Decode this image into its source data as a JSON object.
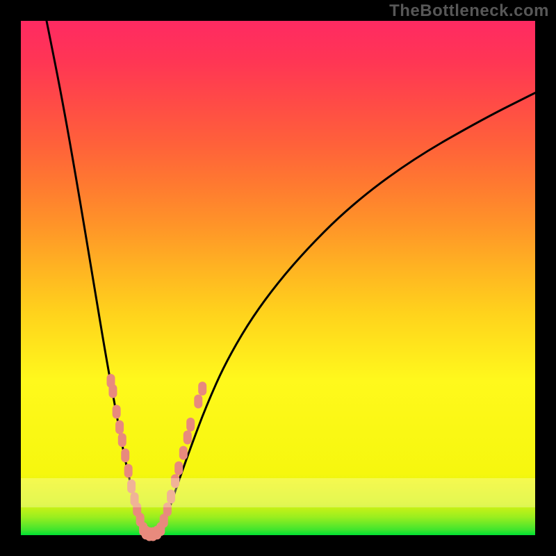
{
  "watermark": "TheBottleneck.com",
  "chart_data": {
    "type": "line",
    "title": "",
    "xlabel": "",
    "ylabel": "",
    "xlim": [
      0,
      100
    ],
    "ylim": [
      0,
      100
    ],
    "curves": [
      {
        "name": "left-falling",
        "x": [
          5,
          8,
          11,
          14,
          16.5,
          18.5,
          20,
          21.3,
          22.4,
          23.2,
          24
        ],
        "y": [
          100,
          85,
          68,
          50,
          35,
          24,
          16,
          10,
          6,
          2.5,
          0
        ]
      },
      {
        "name": "right-rising",
        "x": [
          27,
          28.5,
          30.5,
          33,
          36,
          40,
          46,
          54,
          64,
          76,
          90,
          100
        ],
        "y": [
          0,
          4,
          10,
          17,
          25,
          34,
          44,
          54,
          64,
          73,
          81,
          86
        ]
      }
    ],
    "markers": {
      "name": "cluster-pink-beads",
      "color": "#e88a7d",
      "points": [
        {
          "x": 17.5,
          "y": 30
        },
        {
          "x": 17.9,
          "y": 28
        },
        {
          "x": 18.6,
          "y": 24
        },
        {
          "x": 19.2,
          "y": 21
        },
        {
          "x": 19.7,
          "y": 18.5
        },
        {
          "x": 20.3,
          "y": 15.5
        },
        {
          "x": 20.9,
          "y": 12.5
        },
        {
          "x": 21.5,
          "y": 9.5
        },
        {
          "x": 22.1,
          "y": 7
        },
        {
          "x": 22.6,
          "y": 5
        },
        {
          "x": 23.2,
          "y": 3
        },
        {
          "x": 23.8,
          "y": 1.2
        },
        {
          "x": 24.3,
          "y": 0.5
        },
        {
          "x": 25.0,
          "y": 0.2
        },
        {
          "x": 25.7,
          "y": 0.2
        },
        {
          "x": 26.5,
          "y": 0.5
        },
        {
          "x": 27.2,
          "y": 1.2
        },
        {
          "x": 27.8,
          "y": 2.8
        },
        {
          "x": 28.5,
          "y": 5
        },
        {
          "x": 29.2,
          "y": 7.5
        },
        {
          "x": 30.0,
          "y": 10.5
        },
        {
          "x": 30.7,
          "y": 13
        },
        {
          "x": 31.6,
          "y": 16
        },
        {
          "x": 32.4,
          "y": 19
        },
        {
          "x": 33.0,
          "y": 21.5
        },
        {
          "x": 34.5,
          "y": 26
        },
        {
          "x": 35.3,
          "y": 28.5
        }
      ]
    }
  }
}
